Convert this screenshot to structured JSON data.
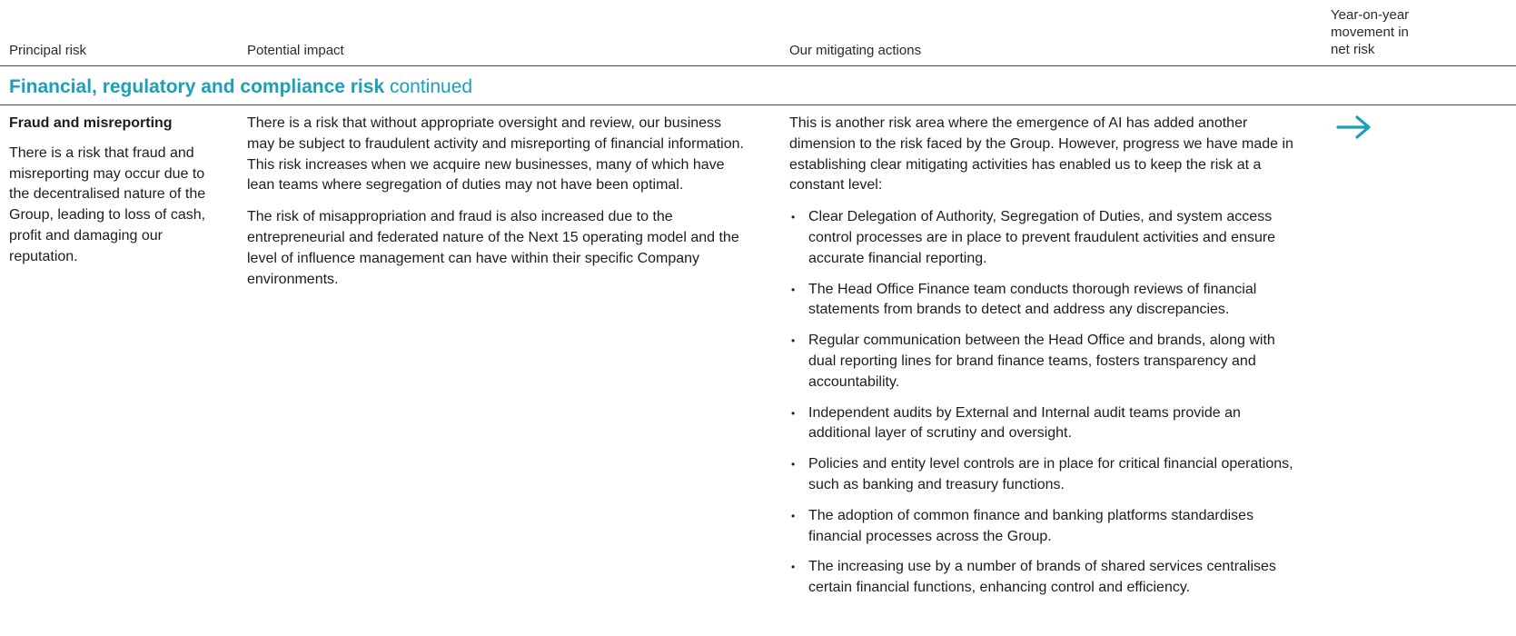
{
  "headers": {
    "principal_risk": "Principal risk",
    "potential_impact": "Potential impact",
    "mitigating_actions": "Our mitigating actions",
    "movement": "Year-on-year movement in net risk"
  },
  "section": {
    "title_bold": "Financial, regulatory and compliance risk",
    "title_suffix": " continued",
    "color": "#1aa0b8"
  },
  "risk": {
    "name": "Fraud and misreporting",
    "description": "There is a risk that fraud and misreporting may occur due to the decentralised nature of the Group, leading to loss of cash, profit and damaging our reputation.",
    "impact": [
      "There is a risk that without appropriate oversight and review, our business may be subject to fraudulent activity and misreporting of financial information. This risk increases when we acquire new businesses, many of which have lean teams where segregation of duties may not have been optimal.",
      "The risk of misappropriation and fraud is also increased due to the entrepreneurial and federated nature of the Next 15 operating model and the level of influence management can have within their specific Company environments."
    ],
    "mitigation_intro": "This is another risk area where the emergence of AI has added another dimension to the risk faced by the Group. However, progress we have made in establishing clear mitigating activities has enabled us to keep the risk at a constant level:",
    "mitigation_points": [
      "Clear Delegation of Authority, Segregation of Duties, and system access control processes are in place to prevent fraudulent activities and ensure accurate financial reporting.",
      "The Head Office Finance team conducts thorough reviews of financial statements from brands to detect and address any discrepancies.",
      "Regular communication between the Head Office and brands, along with dual reporting lines for brand finance teams, fosters transparency and accountability.",
      "Independent audits by External and Internal audit teams provide an additional layer of scrutiny and oversight.",
      "Policies and entity level controls are in place for critical financial operations, such as banking and treasury functions.",
      "The adoption of common finance and banking platforms standardises financial processes across the Group.",
      "The increasing use by a number of brands of shared services centralises certain financial functions, enhancing control and efficiency."
    ],
    "movement_icon": "arrow-right-icon",
    "movement_color": "#1aa0b8"
  }
}
